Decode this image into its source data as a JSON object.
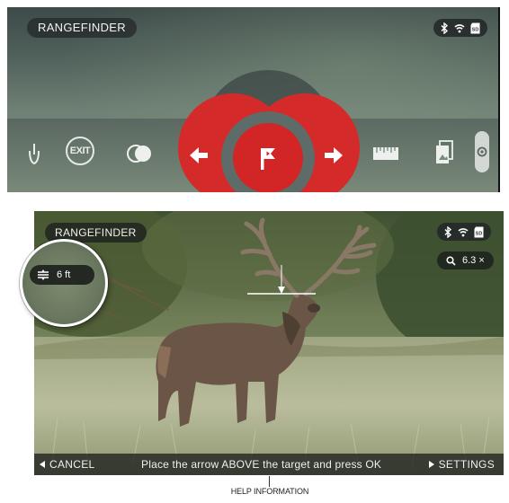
{
  "menu_screen": {
    "title": "RANGEFINDER",
    "status_icons": [
      "bluetooth-icon",
      "wifi-icon",
      "sd-card-icon"
    ],
    "sd_label": "SD",
    "items": [
      {
        "name": "dial-icon"
      },
      {
        "name": "exit-button",
        "label": "EXIT"
      },
      {
        "name": "contrast-icon"
      },
      {
        "name": "arrow-left-icon"
      },
      {
        "name": "flag-icon"
      },
      {
        "name": "arrow-right-icon"
      },
      {
        "name": "ruler-icon"
      },
      {
        "name": "gallery-icon"
      },
      {
        "name": "camera-icon"
      }
    ],
    "accent_color": "#d52a2a"
  },
  "scene_screen": {
    "title": "RANGEFINDER",
    "status_icons": [
      "bluetooth-icon",
      "wifi-icon",
      "sd-card-icon"
    ],
    "sd_label": "SD",
    "zoom": "6.3 ×",
    "range_value": "6 ft",
    "cancel_label": "CANCEL",
    "hint": "Place  the arrow ABOVE the target and press OK",
    "settings_label": "SETTINGS"
  },
  "caption": "HELP INFORMATION"
}
